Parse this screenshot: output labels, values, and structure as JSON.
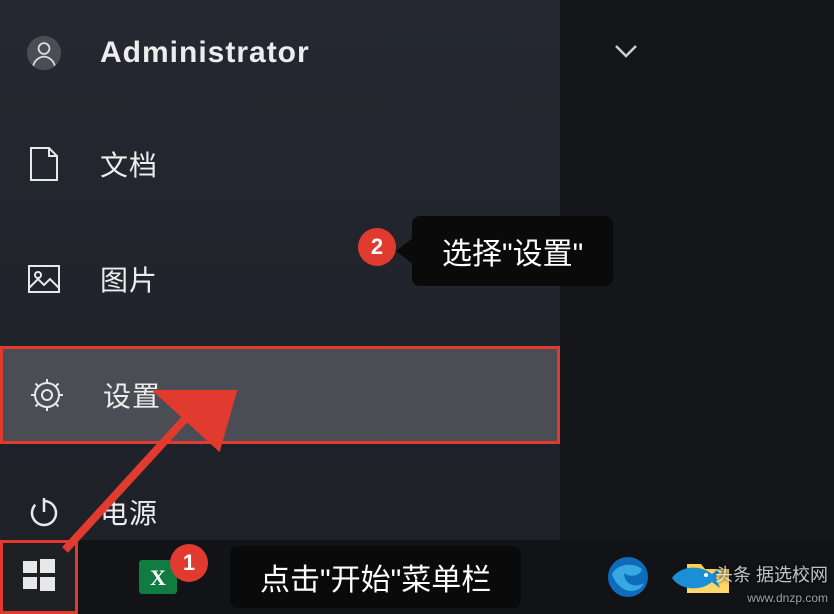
{
  "user": {
    "name": "Administrator"
  },
  "menu": {
    "documents": "文档",
    "pictures": "图片",
    "settings": "设置",
    "power": "电源"
  },
  "callouts": {
    "c1_text": "点击\"开始\"菜单栏",
    "c2_text": "选择\"设置\""
  },
  "badges": {
    "b1": "1",
    "b2": "2"
  },
  "watermark": {
    "prefix": "头条",
    "main": "据选校网",
    "sub": "www.dnzp.com"
  }
}
